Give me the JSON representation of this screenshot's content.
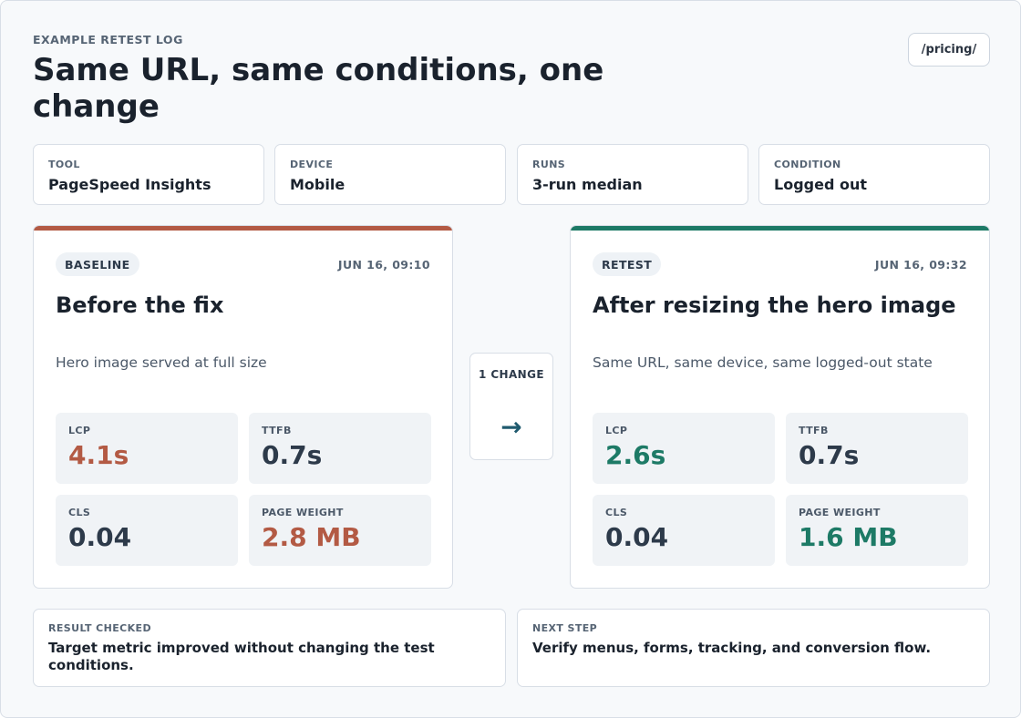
{
  "header": {
    "eyebrow": "EXAMPLE RETEST LOG",
    "title": "Same URL, same conditions, one change",
    "url": "/pricing/"
  },
  "conditions": [
    {
      "label": "TOOL",
      "value": "PageSpeed Insights"
    },
    {
      "label": "DEVICE",
      "value": "Mobile"
    },
    {
      "label": "RUNS",
      "value": "3-run median"
    },
    {
      "label": "CONDITION",
      "value": "Logged out"
    }
  ],
  "baseline": {
    "badge": "BASELINE",
    "timestamp": "JUN 16, 09:10",
    "title": "Before the fix",
    "description": "Hero image served at full size",
    "accent_color": "#b35a44",
    "metrics": [
      {
        "label": "LCP",
        "value": "4.1s",
        "color": "#b35a44"
      },
      {
        "label": "TTFB",
        "value": "0.7s",
        "color": "#2d3a4a"
      },
      {
        "label": "CLS",
        "value": "0.04",
        "color": "#2d3a4a"
      },
      {
        "label": "PAGE WEIGHT",
        "value": "2.8 MB",
        "color": "#b35a44"
      }
    ]
  },
  "change": {
    "label": "1 CHANGE",
    "icon": "arrow-right-icon",
    "arrow": "→"
  },
  "retest": {
    "badge": "RETEST",
    "timestamp": "JUN 16, 09:32",
    "title": "After resizing the hero image",
    "description": "Same URL, same device, same logged-out state",
    "accent_color": "#1d7a66",
    "metrics": [
      {
        "label": "LCP",
        "value": "2.6s",
        "color": "#1d7a66"
      },
      {
        "label": "TTFB",
        "value": "0.7s",
        "color": "#2d3a4a"
      },
      {
        "label": "CLS",
        "value": "0.04",
        "color": "#2d3a4a"
      },
      {
        "label": "PAGE WEIGHT",
        "value": "1.6 MB",
        "color": "#1d7a66"
      }
    ]
  },
  "footer": {
    "result": {
      "label": "RESULT CHECKED",
      "text": "Target metric improved without changing the test conditions."
    },
    "next": {
      "label": "NEXT STEP",
      "text": "Verify menus, forms, tracking, and conversion flow."
    }
  }
}
